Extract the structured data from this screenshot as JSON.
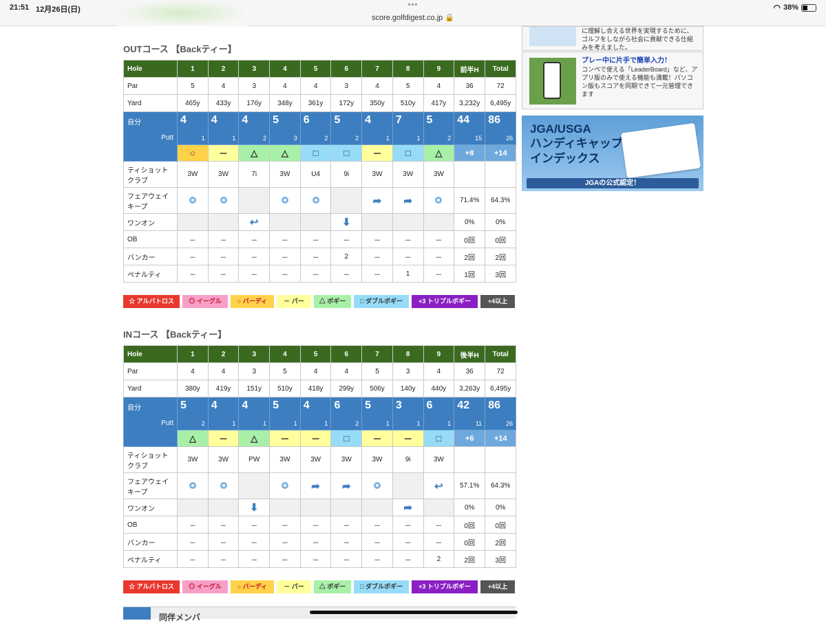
{
  "status_bar": {
    "time": "21:51",
    "date": "12月26日(日)",
    "url": "score.golfdigest.co.jp 🔒",
    "battery": "38%"
  },
  "out": {
    "title": "OUTコース 【Backティー】",
    "hdr": [
      "Hole",
      "1",
      "2",
      "3",
      "4",
      "5",
      "6",
      "7",
      "8",
      "9",
      "前半H",
      "Total"
    ],
    "par": [
      "Par",
      "5",
      "4",
      "3",
      "4",
      "4",
      "3",
      "4",
      "5",
      "4",
      "36",
      "72"
    ],
    "yard": [
      "Yard",
      "465y",
      "433y",
      "176y",
      "348y",
      "361y",
      "172y",
      "350y",
      "510y",
      "417y",
      "3,232y",
      "6,495y"
    ],
    "self_label": "自分",
    "putt_label": "Putt",
    "scores": [
      "4",
      "4",
      "4",
      "5",
      "6",
      "5",
      "4",
      "7",
      "5",
      "44",
      "86"
    ],
    "putts": [
      "1",
      "1",
      "2",
      "3",
      "2",
      "2",
      "1",
      "1",
      "2",
      "15",
      "26"
    ],
    "results": [
      "○",
      "－",
      "△",
      "△",
      "□",
      "□",
      "－",
      "□",
      "△",
      "+8",
      "+14"
    ],
    "result_types": [
      "birdie",
      "par",
      "bogey",
      "bogey",
      "dbl",
      "dbl",
      "par",
      "dbl",
      "bogey",
      "sum",
      "sum"
    ],
    "club_label": "ティショット\nクラブ",
    "clubs": [
      "3W",
      "3W",
      "7i",
      "3W",
      "U4",
      "9i",
      "3W",
      "3W",
      "3W",
      "",
      ""
    ],
    "fw_label": "フェアウェイ\nキープ",
    "fw": [
      "dot",
      "dot",
      "gray",
      "dot",
      "dot",
      "gray",
      "right",
      "right",
      "dot",
      "71.4%",
      "64.3%"
    ],
    "on_label": "ワンオン",
    "on": [
      "gray",
      "gray",
      "left",
      "gray",
      "gray",
      "down",
      "gray",
      "gray",
      "gray",
      "0%",
      "0%"
    ],
    "ob_label": "OB",
    "ob": [
      "－",
      "－",
      "－",
      "－",
      "－",
      "－",
      "－",
      "－",
      "－",
      "0回",
      "0回"
    ],
    "bunker_label": "バンカー",
    "bunker": [
      "－",
      "－",
      "－",
      "－",
      "－",
      "2",
      "－",
      "－",
      "－",
      "2回",
      "2回"
    ],
    "penalty_label": "ペナルティ",
    "penalty": [
      "－",
      "－",
      "－",
      "－",
      "－",
      "－",
      "－",
      "1",
      "－",
      "1回",
      "3回"
    ]
  },
  "in": {
    "title": "INコース 【Backティー】",
    "hdr": [
      "Hole",
      "1",
      "2",
      "3",
      "4",
      "5",
      "6",
      "7",
      "8",
      "9",
      "後半H",
      "Total"
    ],
    "par": [
      "Par",
      "4",
      "4",
      "3",
      "5",
      "4",
      "4",
      "5",
      "3",
      "4",
      "36",
      "72"
    ],
    "yard": [
      "Yard",
      "380y",
      "419y",
      "151y",
      "510y",
      "418y",
      "299y",
      "506y",
      "140y",
      "440y",
      "3,263y",
      "6,495y"
    ],
    "self_label": "自分",
    "putt_label": "Putt",
    "scores": [
      "5",
      "4",
      "4",
      "5",
      "4",
      "6",
      "5",
      "3",
      "6",
      "42",
      "86"
    ],
    "putts": [
      "2",
      "1",
      "1",
      "1",
      "1",
      "2",
      "1",
      "1",
      "1",
      "11",
      "26"
    ],
    "results": [
      "△",
      "－",
      "△",
      "－",
      "－",
      "□",
      "－",
      "－",
      "□",
      "+6",
      "+14"
    ],
    "result_types": [
      "bogey",
      "par",
      "bogey",
      "par",
      "par",
      "dbl",
      "par",
      "par",
      "dbl",
      "sum",
      "sum"
    ],
    "club_label": "ティショット\nクラブ",
    "clubs": [
      "3W",
      "3W",
      "PW",
      "3W",
      "3W",
      "3W",
      "3W",
      "9i",
      "3W",
      "",
      ""
    ],
    "fw_label": "フェアウェイ\nキープ",
    "fw": [
      "dot",
      "dot",
      "gray",
      "dot",
      "right",
      "right",
      "dot",
      "gray",
      "left",
      "57.1%",
      "64.3%"
    ],
    "on_label": "ワンオン",
    "on": [
      "gray",
      "gray",
      "down",
      "gray",
      "gray",
      "gray",
      "gray",
      "right",
      "gray",
      "0%",
      "0%"
    ],
    "ob_label": "OB",
    "ob": [
      "－",
      "－",
      "－",
      "－",
      "－",
      "－",
      "－",
      "－",
      "－",
      "0回",
      "0回"
    ],
    "bunker_label": "バンカー",
    "bunker": [
      "－",
      "－",
      "－",
      "－",
      "－",
      "－",
      "－",
      "－",
      "－",
      "0回",
      "2回"
    ],
    "penalty_label": "ペナルティ",
    "penalty": [
      "－",
      "－",
      "－",
      "－",
      "－",
      "－",
      "－",
      "－",
      "2",
      "2回",
      "3回"
    ]
  },
  "legend": [
    {
      "label": "☆ アルバトロス",
      "bg": "#e8382e",
      "fg": "#fff"
    },
    {
      "label": "◎ イーグル",
      "bg": "#f6a0c8",
      "fg": "#c8102e"
    },
    {
      "label": "○ バーディ",
      "bg": "#ffd24a",
      "fg": "#c8102e"
    },
    {
      "label": "－ パー",
      "bg": "#ffff9c",
      "fg": "#333"
    },
    {
      "label": "△ ボギー",
      "bg": "#a8f0a8",
      "fg": "#333"
    },
    {
      "label": "□ ダブルボギー",
      "bg": "#96dcf8",
      "fg": "#333"
    },
    {
      "label": "+3 トリプルボギー",
      "bg": "#8a1fc4",
      "fg": "#fff"
    },
    {
      "label": "+4以上",
      "bg": "#555",
      "fg": "#fff"
    }
  ],
  "sidebar": {
    "ad1_text": "に理解し合える世界を実現するために、ゴルフをしながら社会に貢献できる仕組みを考えました。",
    "ad2_title": "プレー中に片手で簡単入力！",
    "ad2_text": "コンペで使える「LeaderBoard」など、アプリ版のみで使える機能も満載！パソコン版もスコアを同期できて一元管理できます",
    "jga_title1": "JGA/USGA",
    "jga_title2": "ハンディキャップ\nインデックス",
    "jga_bar": "JGAの公式認定！"
  },
  "bottom_label": "同伴メンバ"
}
